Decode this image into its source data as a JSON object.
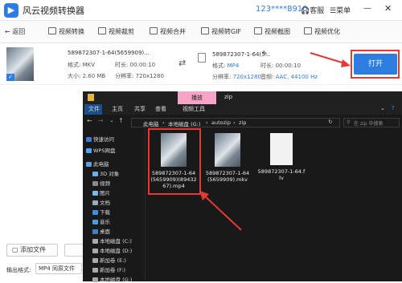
{
  "app": {
    "title": "风云视频转换器",
    "user_id": "123****8910",
    "service_label": "客服",
    "menu_label": "菜单"
  },
  "nav": {
    "back_label": "返回",
    "items": [
      {
        "label": "视频转换"
      },
      {
        "label": "视频裁剪"
      },
      {
        "label": "视频合并"
      },
      {
        "label": "视频转GIF"
      },
      {
        "label": "视频截图"
      },
      {
        "label": "视频优化"
      }
    ]
  },
  "task": {
    "source": {
      "filename": "589872307-1-64(5659909)...",
      "format_label": "格式: MKV",
      "size_label": "大小: 2.60 MB",
      "duration_label": "时长: 00:00:10",
      "resolution_label": "分辨率: 720x1280"
    },
    "output": {
      "filename": "589872307-1-64(5...",
      "format_label": "格式:",
      "format_value": "MP4",
      "duration_label": "时长: 00:00:10",
      "resolution_label": "分辨率:",
      "resolution_value": "720x1280",
      "audio_label": "音频:",
      "audio_value": "AAC, 44100 Hz"
    },
    "open_label": "打开"
  },
  "bottom": {
    "add_file_label": "添加文件",
    "output_format_label": "输出格式:",
    "output_format_value": "MP4 同原文件"
  },
  "explorer": {
    "title_path": "zip",
    "play_tab": "播放",
    "video_tools": "视频工具",
    "ribbon": [
      "文件",
      "主页",
      "共享",
      "查看"
    ],
    "breadcrumb": [
      "此电脑",
      "本地磁盘 (G:)",
      "autozip",
      "zip"
    ],
    "search_placeholder": "在 zip 中搜索",
    "sidebar": [
      "快速访问",
      "WPS网盘",
      "此电脑",
      "3D 对象",
      "视频",
      "图片",
      "文档",
      "下载",
      "音乐",
      "桌面",
      "本地磁盘 (C:)",
      "本地磁盘 (D:)",
      "新加卷 (E:)",
      "新加卷 (F:)",
      "本地磁盘 (G:)"
    ],
    "files": [
      {
        "name": "589872307-1-64(5659909)(8943267).mp4"
      },
      {
        "name": "589872307-1-64(5659909).mkv"
      },
      {
        "name": "589872307-1-64.flv"
      }
    ]
  },
  "colors": {
    "accent": "#2e7de1",
    "highlight_red": "#e53935",
    "explorer_bg": "#191919"
  }
}
